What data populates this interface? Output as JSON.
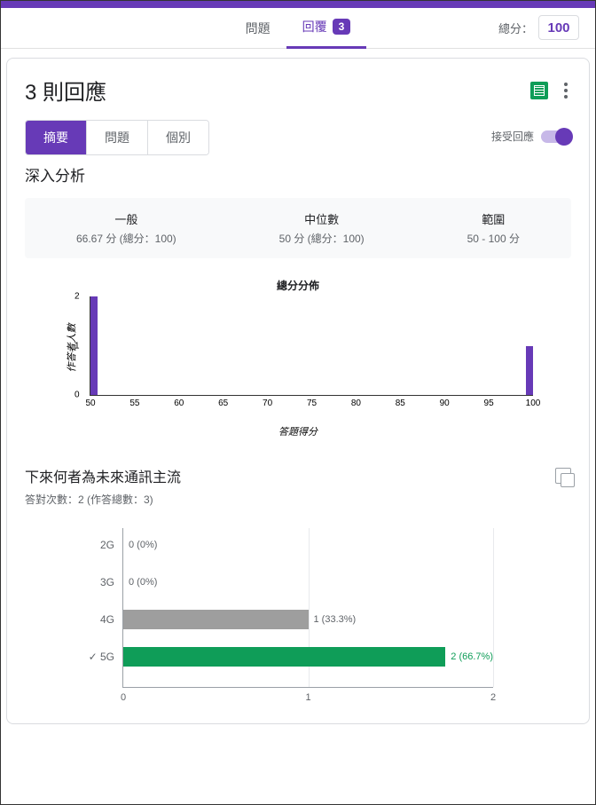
{
  "header": {
    "tab_questions": "問題",
    "tab_responses": "回覆",
    "response_count_badge": "3",
    "total_points_label": "總分：",
    "total_points_value": "100"
  },
  "responses_card": {
    "title": "3 則回應",
    "seg_summary": "摘要",
    "seg_question": "問題",
    "seg_individual": "個別",
    "accept_label": "接受回應"
  },
  "insights": {
    "title": "深入分析",
    "stat_avg_label": "一般",
    "stat_avg_value": "66.67 分 (總分：100)",
    "stat_median_label": "中位數",
    "stat_median_value": "50 分 (總分：100)",
    "stat_range_label": "範圍",
    "stat_range_value": "50 - 100 分"
  },
  "chart_data": [
    {
      "type": "bar",
      "title": "總分分佈",
      "xlabel": "答題得分",
      "ylabel": "作答者人數",
      "categories": [
        50,
        55,
        60,
        65,
        70,
        75,
        80,
        85,
        90,
        95,
        100
      ],
      "values": [
        2,
        0,
        0,
        0,
        0,
        0,
        0,
        0,
        0,
        0,
        1
      ],
      "ylim": [
        0,
        2
      ],
      "xlim": [
        50,
        100
      ]
    },
    {
      "type": "bar",
      "orientation": "horizontal",
      "title": "下來何者為未來通訊主流",
      "subtitle": "答對次數：2 (作答總數：3)",
      "categories": [
        "2G",
        "3G",
        "4G",
        "5G"
      ],
      "correct_index": 3,
      "values": [
        0,
        0,
        1,
        2
      ],
      "percent_labels": [
        "0 (0%)",
        "0 (0%)",
        "1 (33.3%)",
        "2 (66.7%)"
      ],
      "xlim": [
        0,
        2
      ],
      "xticks": [
        0,
        1,
        2
      ],
      "colors": [
        "#9e9e9e",
        "#9e9e9e",
        "#9e9e9e",
        "#0f9d58"
      ]
    }
  ]
}
